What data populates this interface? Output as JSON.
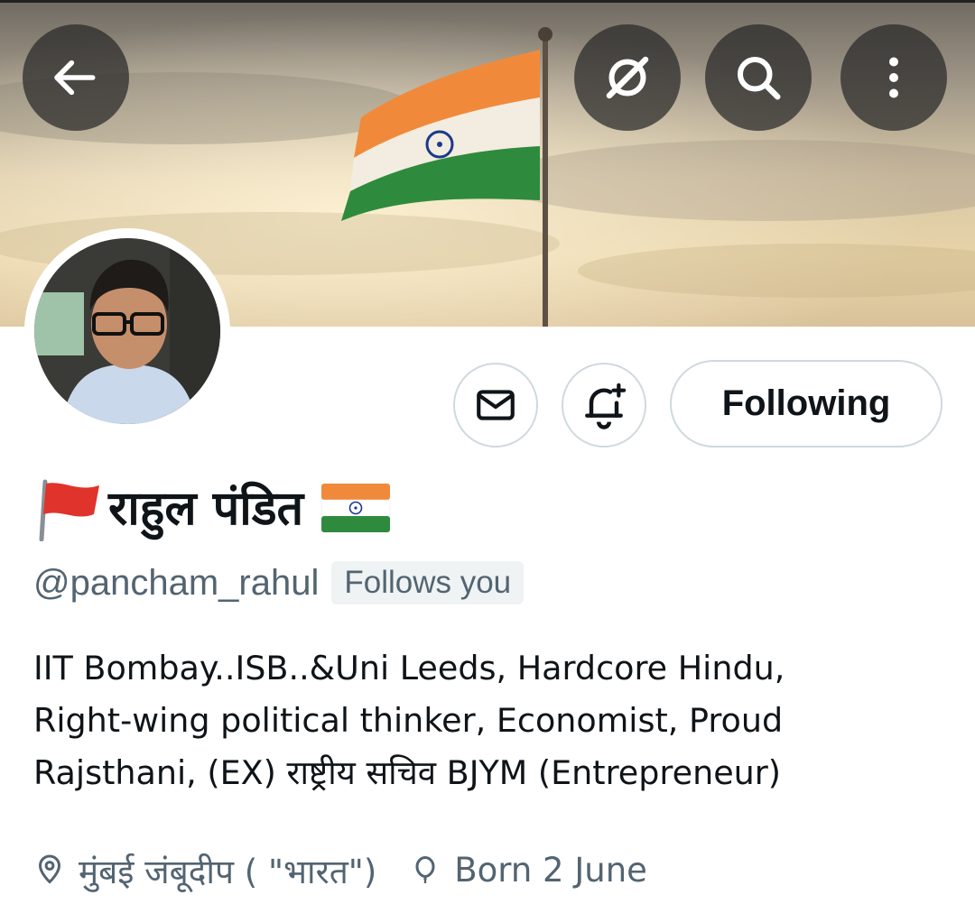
{
  "header": {
    "back_icon": "arrow-left-icon",
    "grok_icon": "grok-icon",
    "search_icon": "search-icon",
    "more_icon": "more-vertical-icon"
  },
  "actions": {
    "message_icon": "envelope-icon",
    "notify_icon": "bell-plus-icon",
    "following_label": "Following"
  },
  "profile": {
    "name_prefix_emoji": "🚩",
    "display_name": "राहुल पंडित",
    "name_suffix_emoji": "india-flag-emoji",
    "handle": "@pancham_rahul",
    "follows_you": "Follows you",
    "bio_lines": [
      "IIT Bombay..ISB..&Uni Leeds, Hardcore Hindu,",
      "Right-wing political thinker, Economist, Proud",
      "Rajsthani, (EX) राष्ट्रीय सचिव BJYM (Entrepreneur)"
    ],
    "location": "मुंबई  जंबूदीप ( \"भारत\")",
    "birthday": "Born 2 June"
  },
  "colors": {
    "secondary_text": "#536471",
    "border": "#cfd9de",
    "saffron": "#f08a3a",
    "green": "#2e8b3d",
    "chakra": "#1a3a8a"
  }
}
